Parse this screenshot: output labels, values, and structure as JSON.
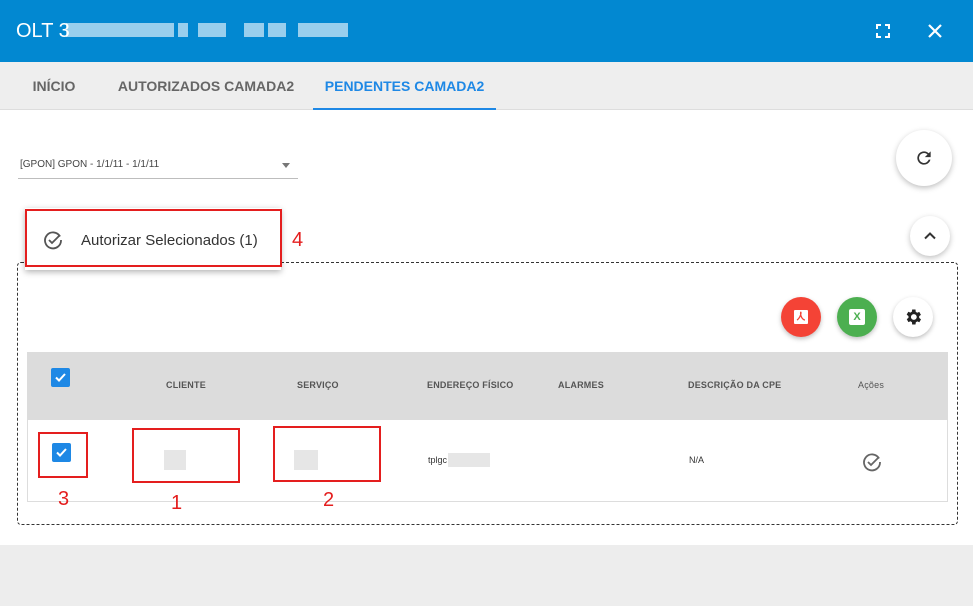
{
  "window": {
    "title": "OLT 3"
  },
  "tabs": [
    {
      "label": "INÍCIO"
    },
    {
      "label": "AUTORIZADOS CAMADA2"
    },
    {
      "label": "PENDENTES CAMADA2"
    }
  ],
  "filter": {
    "selected": "[GPON] GPON - 1/1/11 - 1/1/11"
  },
  "menu": {
    "authorize_label": "Autorizar Selecionados (1)"
  },
  "table": {
    "headers": [
      "CLIENTE",
      "SERVIÇO",
      "ENDEREÇO FÍSICO",
      "ALARMES",
      "DESCRIÇÃO DA CPE",
      "Ações"
    ],
    "rows": [
      {
        "cliente": "",
        "servico": "",
        "endereco": "tplgc",
        "alarmes": "",
        "descricao": "N/A"
      }
    ]
  },
  "export": {
    "pdf_icon": "pdf-icon",
    "excel_label": "X"
  },
  "annotations": {
    "a1": "1",
    "a2": "2",
    "a3": "3",
    "a4": "4"
  },
  "colors": {
    "header": "#0288d1",
    "accent": "#1e88e5",
    "pdf": "#f44336",
    "excel": "#4caf50",
    "annotation": "#e41e1e"
  }
}
